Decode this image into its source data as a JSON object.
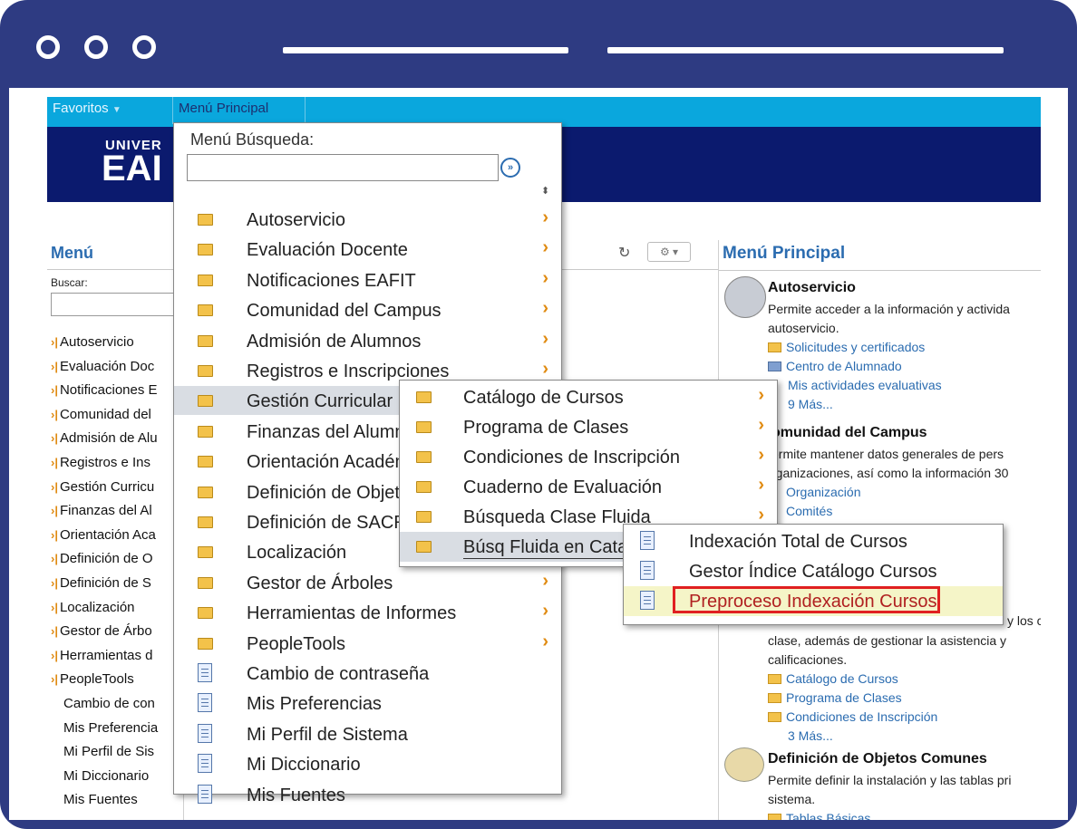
{
  "browser": {
    "dots": 3
  },
  "topnav": {
    "favoritos": "Favoritos",
    "menu_principal": "Menú Principal"
  },
  "banner": {
    "logo_line1": "UNIVER",
    "logo_line2": "EAI"
  },
  "left_panel": {
    "title": "Menú",
    "search_label": "Buscar:",
    "items": [
      {
        "label": "Autoservicio",
        "arrow": true
      },
      {
        "label": "Evaluación Doc",
        "arrow": true
      },
      {
        "label": "Notificaciones E",
        "arrow": true
      },
      {
        "label": "Comunidad del",
        "arrow": true
      },
      {
        "label": "Admisión de Alu",
        "arrow": true
      },
      {
        "label": "Registros e Ins",
        "arrow": true
      },
      {
        "label": "Gestión Curricu",
        "arrow": true
      },
      {
        "label": "Finanzas del Al",
        "arrow": true
      },
      {
        "label": "Orientación Aca",
        "arrow": true
      },
      {
        "label": "Definición de O",
        "arrow": true
      },
      {
        "label": "Definición de S",
        "arrow": true
      },
      {
        "label": "Localización",
        "arrow": true
      },
      {
        "label": "Gestor de Árbo",
        "arrow": true
      },
      {
        "label": "Herramientas d",
        "arrow": true
      },
      {
        "label": "PeopleTools",
        "arrow": true
      },
      {
        "label": "Cambio de con",
        "arrow": false
      },
      {
        "label": "Mis Preferencia",
        "arrow": false
      },
      {
        "label": "Mi Perfil de Sis",
        "arrow": false
      },
      {
        "label": "Mi Diccionario",
        "arrow": false
      },
      {
        "label": "Mis Fuentes",
        "arrow": false
      }
    ]
  },
  "right_panel": {
    "title": "Menú Principal",
    "sections": [
      {
        "heading": "Autoservicio",
        "lines": [
          "Permite acceder a la información y activida",
          "autoservicio."
        ],
        "links": [
          "Solicitudes y certificados",
          "Centro de Alumnado",
          "Mis actividades evaluativas",
          "9 Más..."
        ]
      },
      {
        "heading": "omunidad del Campus",
        "lines": [
          "ermite mantener datos generales de pers",
          "rganizaciones, así como la información 30"
        ],
        "links": [
          "Organización",
          "Comités"
        ]
      },
      {
        "heading": "",
        "lines": [
          "y los c",
          "clase, además de gestionar la asistencia y",
          "calificaciones."
        ],
        "links": [
          "Catálogo de Cursos",
          "Programa de Clases",
          "Condiciones de Inscripción",
          "3 Más..."
        ]
      },
      {
        "heading": "Definición de Objetos Comunes",
        "lines": [
          "Permite definir la instalación y las tablas pri",
          "sistema."
        ],
        "links": [
          "Tablas Básicas"
        ]
      }
    ]
  },
  "dropdown_main": {
    "title": "Menú Búsqueda:",
    "search_value": "",
    "go_icon": "»",
    "items": [
      {
        "label": "Autoservicio",
        "icon": "folder",
        "submenu": true
      },
      {
        "label": "Evaluación Docente",
        "icon": "folder",
        "submenu": true
      },
      {
        "label": "Notificaciones EAFIT",
        "icon": "folder",
        "submenu": true
      },
      {
        "label": "Comunidad del Campus",
        "icon": "folder",
        "submenu": true
      },
      {
        "label": "Admisión de Alumnos",
        "icon": "folder",
        "submenu": true
      },
      {
        "label": "Registros e Inscripciones",
        "icon": "folder",
        "submenu": true
      },
      {
        "label": "Gestión Curricular",
        "icon": "folder",
        "submenu": true,
        "highlighted": true
      },
      {
        "label": "Finanzas del Alumn",
        "icon": "folder",
        "submenu": false
      },
      {
        "label": "Orientación Acadén",
        "icon": "folder",
        "submenu": false
      },
      {
        "label": "Definición de Objeto",
        "icon": "folder",
        "submenu": false
      },
      {
        "label": "Definición de SACR",
        "icon": "folder",
        "submenu": false
      },
      {
        "label": "Localización",
        "icon": "folder",
        "submenu": false
      },
      {
        "label": "Gestor de Árboles",
        "icon": "folder",
        "submenu": true
      },
      {
        "label": "Herramientas de Informes",
        "icon": "folder",
        "submenu": true
      },
      {
        "label": "PeopleTools",
        "icon": "folder",
        "submenu": true
      },
      {
        "label": "Cambio de contraseña",
        "icon": "doc",
        "submenu": false
      },
      {
        "label": "Mis Preferencias",
        "icon": "doc",
        "submenu": false
      },
      {
        "label": "Mi Perfil de Sistema",
        "icon": "doc",
        "submenu": false
      },
      {
        "label": "Mi Diccionario",
        "icon": "doc",
        "submenu": false
      },
      {
        "label": "Mis Fuentes",
        "icon": "doc",
        "submenu": false
      }
    ]
  },
  "dropdown_gestion": {
    "items": [
      {
        "label": "Catálogo de Cursos",
        "submenu": true
      },
      {
        "label": "Programa de Clases",
        "submenu": true
      },
      {
        "label": "Condiciones de Inscripción",
        "submenu": true
      },
      {
        "label": "Cuaderno de Evaluación",
        "submenu": true
      },
      {
        "label": "Búsqueda Clase Fluida",
        "submenu": true
      },
      {
        "label": "Búsq Fluida en Cata",
        "submenu": false,
        "highlighted": true
      }
    ]
  },
  "dropdown_busq": {
    "items": [
      {
        "label": "Indexación Total de Cursos"
      },
      {
        "label": "Gestor Índice Catálogo Cursos"
      },
      {
        "label": "Preproceso Indexación Cursos",
        "highlighted": true
      }
    ]
  },
  "colors": {
    "frame": "#2e3b82",
    "topnav": "#0aa7dd",
    "banner": "#0b1a6e",
    "arrow": "#e08b12",
    "highlight_box": "#e02020"
  }
}
